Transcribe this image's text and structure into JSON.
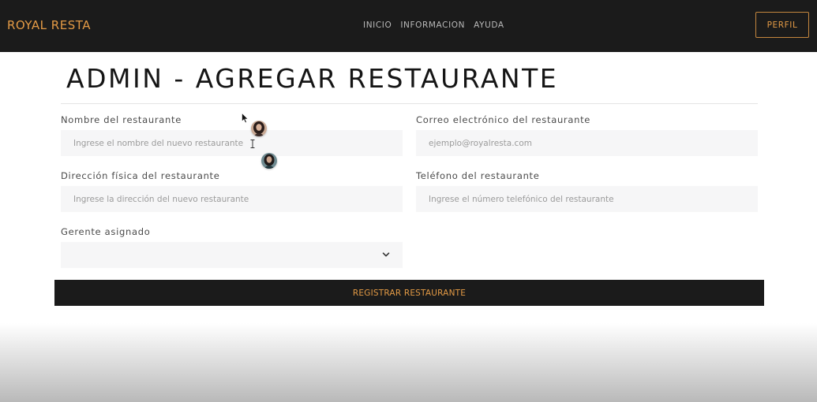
{
  "header": {
    "brand": "ROYAL RESTA",
    "nav": [
      "INICIO",
      "INFORMACION",
      "AYUDA"
    ],
    "profile_button": "PERFIL"
  },
  "page": {
    "title": "ADMIN - AGREGAR RESTAURANTE"
  },
  "form": {
    "name": {
      "label": "Nombre del restaurante",
      "placeholder": "Ingrese el nombre del nuevo restaurante"
    },
    "email": {
      "label": "Correo electrónico del restaurante",
      "placeholder": "ejemplo@royalresta.com"
    },
    "address": {
      "label": "Dirección física del restaurante",
      "placeholder": "Ingrese la dirección del nuevo restaurante"
    },
    "phone": {
      "label": "Teléfono del restaurante",
      "placeholder": "Ingrese el número telefónico del restaurante"
    },
    "manager": {
      "label": "Gerente asignado",
      "selected": ""
    },
    "submit": "REGISTRAR RESTAURANTE"
  },
  "icons": {
    "select_arrow": "chevron-down-icon",
    "cursor": "mouse-pointer-icon",
    "text_cursor": "text-cursor-icon",
    "collaborators": [
      "avatar",
      "avatar"
    ]
  },
  "colors": {
    "navbar_bg": "#1b1b1b",
    "accent": "#e39a45",
    "input_bg": "#f6f6f7"
  }
}
